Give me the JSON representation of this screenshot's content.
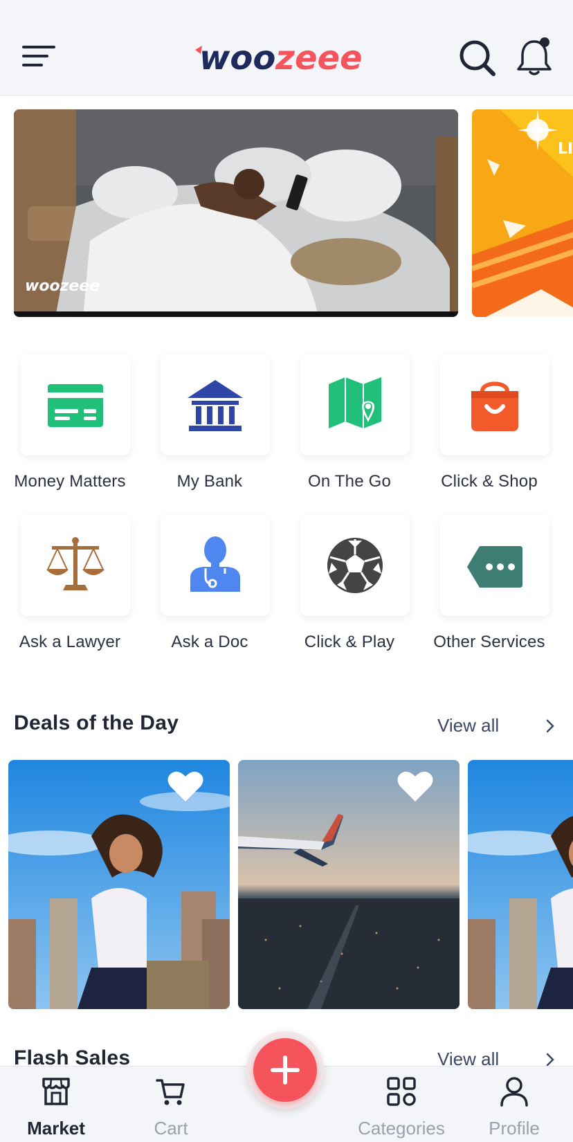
{
  "header": {
    "logo_text": "woozeee",
    "menu_icon": "hamburger-menu-icon",
    "search_icon": "search-icon",
    "notification_icon": "bell-icon"
  },
  "banners": [
    {
      "watermark": "woozeee"
    },
    {
      "partial_text": "LI"
    }
  ],
  "services": [
    {
      "label": "Money Matters",
      "icon": "card-icon",
      "color": "#21c07a"
    },
    {
      "label": "My Bank",
      "icon": "bank-icon",
      "color": "#2f46a8"
    },
    {
      "label": "On The Go",
      "icon": "map-pin-icon",
      "color": "#21c07a"
    },
    {
      "label": "Click & Shop",
      "icon": "shopping-bag-icon",
      "color": "#f25a2b"
    },
    {
      "label": "Ask a Lawyer",
      "icon": "scales-icon",
      "color": "#a76d3b"
    },
    {
      "label": "Ask a Doc",
      "icon": "doctor-icon",
      "color": "#4f86f0"
    },
    {
      "label": "Click & Play",
      "icon": "soccer-ball-icon",
      "color": "#444444"
    },
    {
      "label": "Other Services",
      "icon": "more-tag-icon",
      "color": "#3e7d73"
    }
  ],
  "deals": {
    "title": "Deals of the Day",
    "view_all": "View all"
  },
  "flash_sales": {
    "title": "Flash Sales",
    "view_all": "View all"
  },
  "bottom_nav": {
    "items": [
      {
        "label": "Market",
        "icon": "market-icon",
        "active": true
      },
      {
        "label": "Cart",
        "icon": "cart-icon",
        "active": false
      },
      {
        "label": "Categories",
        "icon": "categories-icon",
        "active": false
      },
      {
        "label": "Profile",
        "icon": "profile-icon",
        "active": false
      }
    ],
    "fab_icon": "plus-icon"
  },
  "colors": {
    "brand_navy": "#1e2a5e",
    "brand_red": "#f5545c",
    "fab": "#f5545c"
  }
}
